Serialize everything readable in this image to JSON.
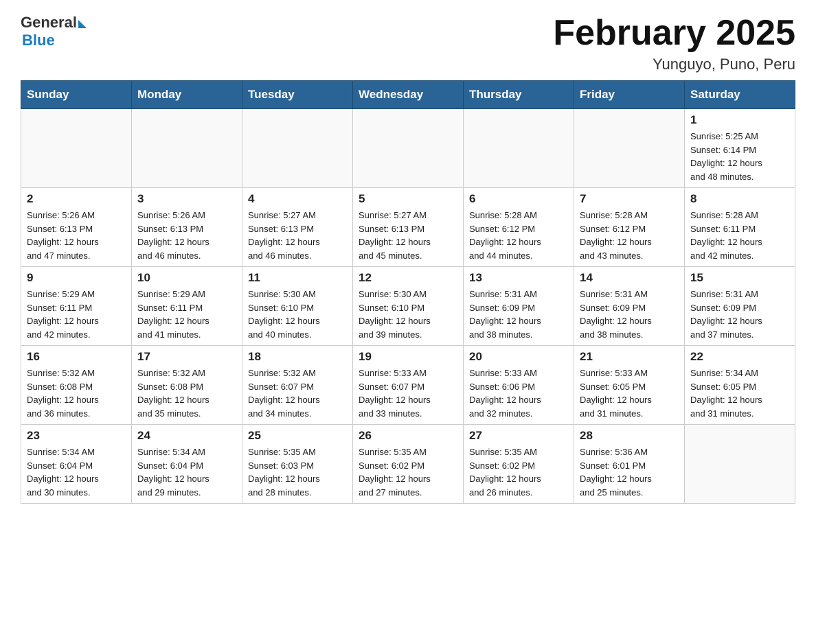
{
  "header": {
    "logo_general": "General",
    "logo_blue": "Blue",
    "title": "February 2025",
    "subtitle": "Yunguyo, Puno, Peru"
  },
  "weekdays": [
    "Sunday",
    "Monday",
    "Tuesday",
    "Wednesday",
    "Thursday",
    "Friday",
    "Saturday"
  ],
  "weeks": [
    [
      {
        "day": "",
        "info": ""
      },
      {
        "day": "",
        "info": ""
      },
      {
        "day": "",
        "info": ""
      },
      {
        "day": "",
        "info": ""
      },
      {
        "day": "",
        "info": ""
      },
      {
        "day": "",
        "info": ""
      },
      {
        "day": "1",
        "info": "Sunrise: 5:25 AM\nSunset: 6:14 PM\nDaylight: 12 hours\nand 48 minutes."
      }
    ],
    [
      {
        "day": "2",
        "info": "Sunrise: 5:26 AM\nSunset: 6:13 PM\nDaylight: 12 hours\nand 47 minutes."
      },
      {
        "day": "3",
        "info": "Sunrise: 5:26 AM\nSunset: 6:13 PM\nDaylight: 12 hours\nand 46 minutes."
      },
      {
        "day": "4",
        "info": "Sunrise: 5:27 AM\nSunset: 6:13 PM\nDaylight: 12 hours\nand 46 minutes."
      },
      {
        "day": "5",
        "info": "Sunrise: 5:27 AM\nSunset: 6:13 PM\nDaylight: 12 hours\nand 45 minutes."
      },
      {
        "day": "6",
        "info": "Sunrise: 5:28 AM\nSunset: 6:12 PM\nDaylight: 12 hours\nand 44 minutes."
      },
      {
        "day": "7",
        "info": "Sunrise: 5:28 AM\nSunset: 6:12 PM\nDaylight: 12 hours\nand 43 minutes."
      },
      {
        "day": "8",
        "info": "Sunrise: 5:28 AM\nSunset: 6:11 PM\nDaylight: 12 hours\nand 42 minutes."
      }
    ],
    [
      {
        "day": "9",
        "info": "Sunrise: 5:29 AM\nSunset: 6:11 PM\nDaylight: 12 hours\nand 42 minutes."
      },
      {
        "day": "10",
        "info": "Sunrise: 5:29 AM\nSunset: 6:11 PM\nDaylight: 12 hours\nand 41 minutes."
      },
      {
        "day": "11",
        "info": "Sunrise: 5:30 AM\nSunset: 6:10 PM\nDaylight: 12 hours\nand 40 minutes."
      },
      {
        "day": "12",
        "info": "Sunrise: 5:30 AM\nSunset: 6:10 PM\nDaylight: 12 hours\nand 39 minutes."
      },
      {
        "day": "13",
        "info": "Sunrise: 5:31 AM\nSunset: 6:09 PM\nDaylight: 12 hours\nand 38 minutes."
      },
      {
        "day": "14",
        "info": "Sunrise: 5:31 AM\nSunset: 6:09 PM\nDaylight: 12 hours\nand 38 minutes."
      },
      {
        "day": "15",
        "info": "Sunrise: 5:31 AM\nSunset: 6:09 PM\nDaylight: 12 hours\nand 37 minutes."
      }
    ],
    [
      {
        "day": "16",
        "info": "Sunrise: 5:32 AM\nSunset: 6:08 PM\nDaylight: 12 hours\nand 36 minutes."
      },
      {
        "day": "17",
        "info": "Sunrise: 5:32 AM\nSunset: 6:08 PM\nDaylight: 12 hours\nand 35 minutes."
      },
      {
        "day": "18",
        "info": "Sunrise: 5:32 AM\nSunset: 6:07 PM\nDaylight: 12 hours\nand 34 minutes."
      },
      {
        "day": "19",
        "info": "Sunrise: 5:33 AM\nSunset: 6:07 PM\nDaylight: 12 hours\nand 33 minutes."
      },
      {
        "day": "20",
        "info": "Sunrise: 5:33 AM\nSunset: 6:06 PM\nDaylight: 12 hours\nand 32 minutes."
      },
      {
        "day": "21",
        "info": "Sunrise: 5:33 AM\nSunset: 6:05 PM\nDaylight: 12 hours\nand 31 minutes."
      },
      {
        "day": "22",
        "info": "Sunrise: 5:34 AM\nSunset: 6:05 PM\nDaylight: 12 hours\nand 31 minutes."
      }
    ],
    [
      {
        "day": "23",
        "info": "Sunrise: 5:34 AM\nSunset: 6:04 PM\nDaylight: 12 hours\nand 30 minutes."
      },
      {
        "day": "24",
        "info": "Sunrise: 5:34 AM\nSunset: 6:04 PM\nDaylight: 12 hours\nand 29 minutes."
      },
      {
        "day": "25",
        "info": "Sunrise: 5:35 AM\nSunset: 6:03 PM\nDaylight: 12 hours\nand 28 minutes."
      },
      {
        "day": "26",
        "info": "Sunrise: 5:35 AM\nSunset: 6:02 PM\nDaylight: 12 hours\nand 27 minutes."
      },
      {
        "day": "27",
        "info": "Sunrise: 5:35 AM\nSunset: 6:02 PM\nDaylight: 12 hours\nand 26 minutes."
      },
      {
        "day": "28",
        "info": "Sunrise: 5:36 AM\nSunset: 6:01 PM\nDaylight: 12 hours\nand 25 minutes."
      },
      {
        "day": "",
        "info": ""
      }
    ]
  ]
}
